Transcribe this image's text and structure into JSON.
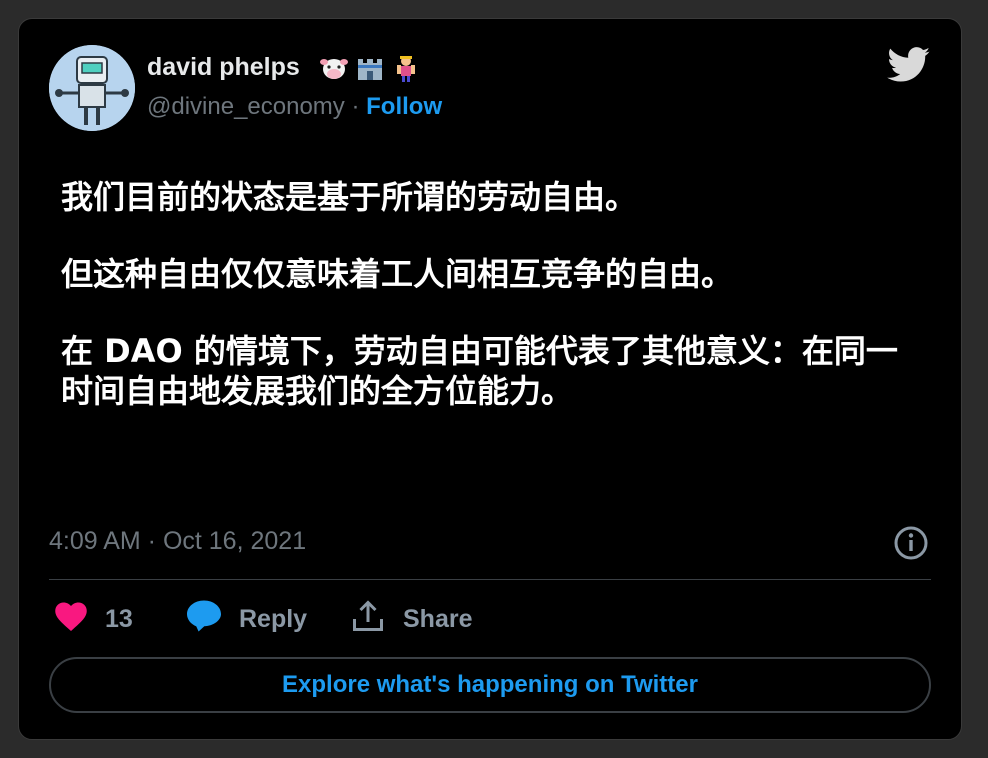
{
  "author": {
    "display_name": "david phelps",
    "handle": "@divine_economy",
    "separator": " · ",
    "follow_label": "Follow",
    "emoji_icons": [
      "cow-face-icon",
      "castle-icon",
      "superhero-icon"
    ]
  },
  "tweet": {
    "paragraphs": [
      "我们目前的状态是基于所谓的劳动自由。",
      "但这种自由仅仅意味着工人间相互竞争的自由。",
      "在 DAO 的情境下，劳动自由可能代表了其他意义：在同一时间自由地发展我们的全方位能力。"
    ],
    "timestamp": "4:09 AM · Oct 16, 2021"
  },
  "actions": {
    "like_count": "13",
    "reply_label": "Reply",
    "share_label": "Share"
  },
  "explore_label": "Explore what's happening on Twitter",
  "colors": {
    "background": "#000000",
    "accent": "#1d9bf0",
    "muted": "#6e767d",
    "like": "#f91880"
  }
}
